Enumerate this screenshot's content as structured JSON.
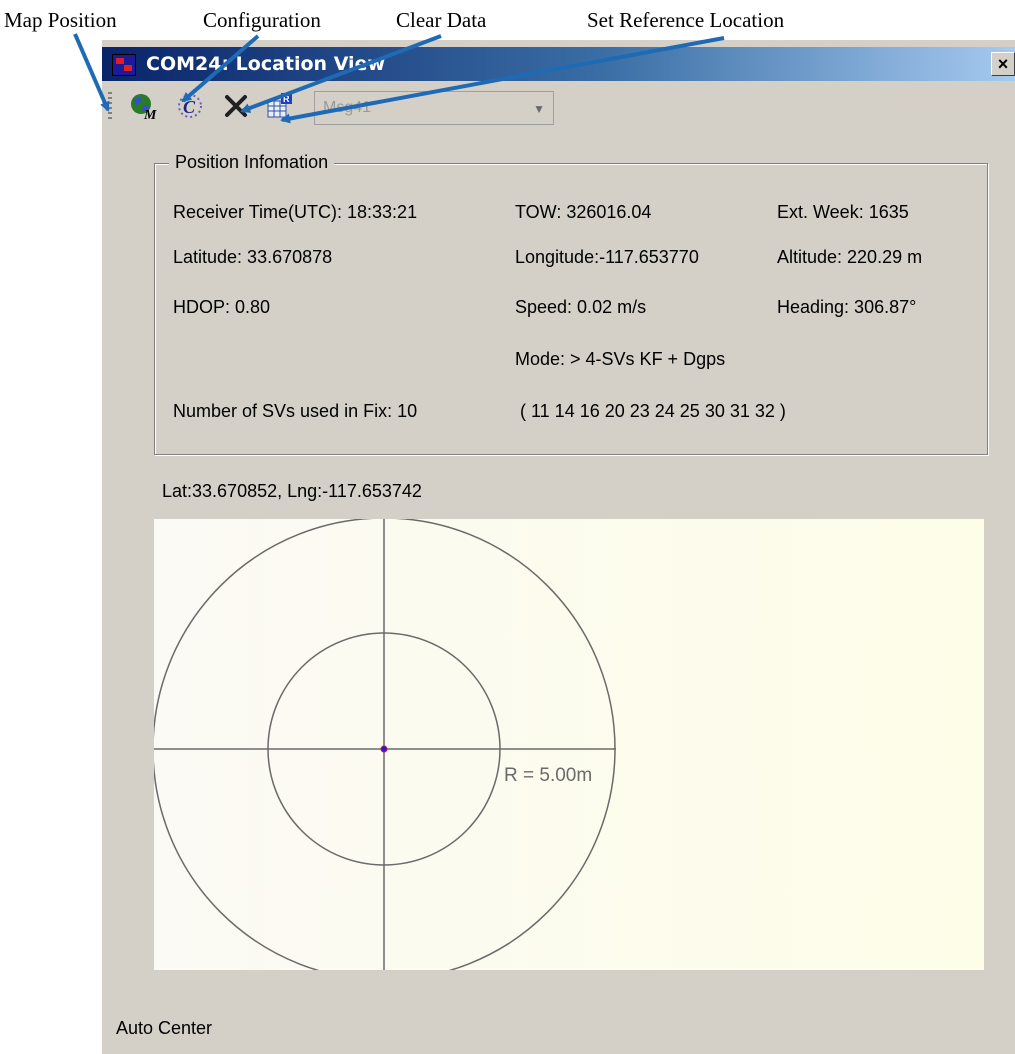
{
  "annotations": {
    "map_position": "Map Position",
    "configuration": "Configuration",
    "clear_data": "Clear Data",
    "set_reference": "Set Reference Location"
  },
  "window": {
    "title": "COM24: Location View",
    "close": "×"
  },
  "toolbar": {
    "icons": [
      "map-position-icon",
      "configuration-icon",
      "clear-data-icon",
      "set-reference-location-icon"
    ],
    "message_select": "Msg41"
  },
  "position_info": {
    "title": "Position Infomation",
    "receiver_time": "Receiver Time(UTC): 18:33:21",
    "tow": "TOW: 326016.04",
    "ext_week": "Ext. Week: 1635",
    "latitude": "Latitude: 33.670878",
    "longitude": "Longitude:-117.653770",
    "altitude": "Altitude: 220.29 m",
    "hdop": "HDOP: 0.80",
    "speed": "Speed: 0.02 m/s",
    "heading": "Heading: 306.87°",
    "mode": "Mode: > 4-SVs KF + Dgps",
    "num_svs": "Number of SVs used in Fix: 10",
    "sv_list": "( 11 14 16 20 23 24 25 30 31 32 )"
  },
  "map": {
    "cursor_coord": "Lat:33.670852, Lng:-117.653742",
    "radius_label": "R = 5.00m",
    "background_color": "#fefde8",
    "position_dot_color": "#2020d0"
  },
  "status": {
    "text": "Auto Center"
  }
}
